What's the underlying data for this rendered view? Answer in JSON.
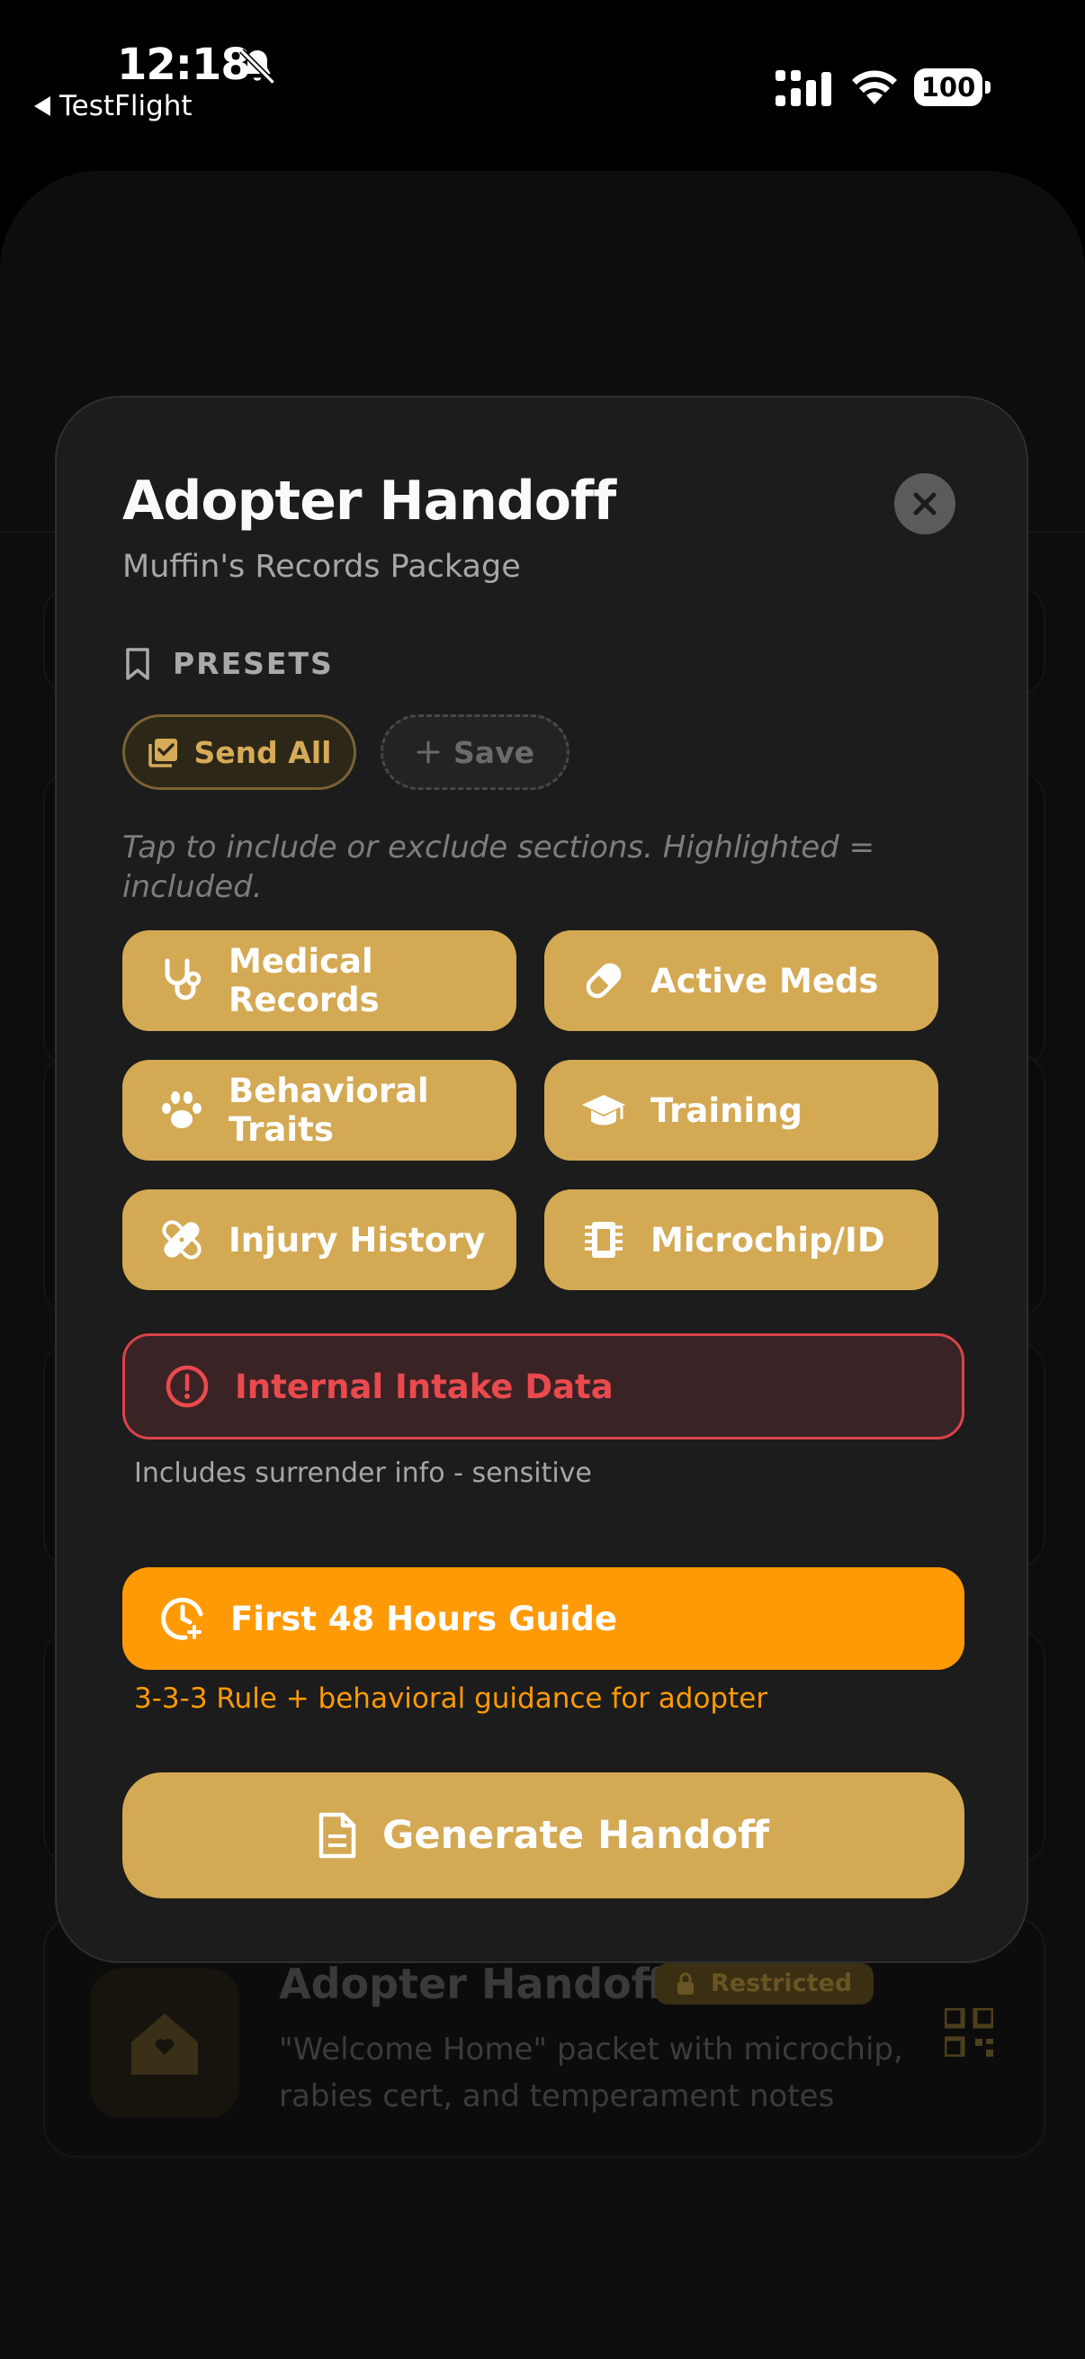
{
  "status_bar": {
    "time": "12:18",
    "back_label": "TestFlight",
    "battery": "100"
  },
  "background": {
    "handoff_card": {
      "title": "Adopter Handoff",
      "badge": "Restricted",
      "description": "\"Welcome Home\" packet with microchip, rabies cert, and temperament notes"
    }
  },
  "modal": {
    "title": "Adopter Handoff",
    "subtitle": "Muffin's Records Package",
    "presets_label": "PRESETS",
    "preset_send_all": "Send All",
    "preset_save": "Save",
    "hint": "Tap to include or exclude sections. Highlighted = included.",
    "sections": [
      {
        "label": "Medical Records",
        "icon": "stethoscope-icon"
      },
      {
        "label": "Active Meds",
        "icon": "pill-icon"
      },
      {
        "label": "Behavioral Traits",
        "icon": "paw-icon"
      },
      {
        "label": "Training",
        "icon": "graduation-cap-icon"
      },
      {
        "label": "Injury History",
        "icon": "bandage-icon"
      },
      {
        "label": "Microchip/ID",
        "icon": "chip-icon"
      }
    ],
    "internal": {
      "label": "Internal Intake Data",
      "note": "Includes surrender info - sensitive"
    },
    "guide": {
      "label": "First 48 Hours Guide",
      "note": "3-3-3 Rule + behavioral guidance for adopter"
    },
    "generate_label": "Generate Handoff"
  },
  "colors": {
    "accent_gold": "#d4a954",
    "warning_red": "#e8474c",
    "guide_orange": "#ff9a05",
    "modal_bg": "#1b1c1b"
  }
}
